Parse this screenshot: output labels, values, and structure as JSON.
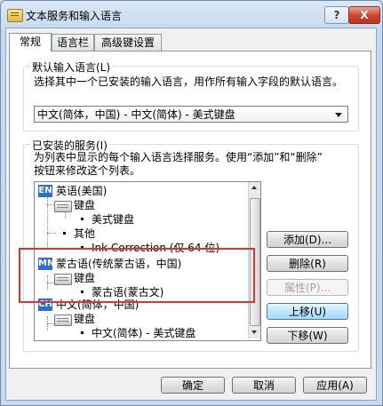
{
  "window": {
    "title": "文本服务和输入语言",
    "help_label": "?",
    "close_label": "X"
  },
  "tabs": [
    {
      "label": "常规",
      "active": true
    },
    {
      "label": "语言栏",
      "active": false
    },
    {
      "label": "高级键设置",
      "active": false
    }
  ],
  "default_lang_group": {
    "label": "默认输入语言(L)",
    "description": "选择其中一个已安装的输入语言，用作所有输入字段的默认语言。",
    "selected_value": "中文(简体，中国) - 中文(简体) - 美式键盘"
  },
  "services_group": {
    "label": "已安装的服务(I)",
    "description_line1": "为列表中显示的每个输入语言选择服务。使用“添加”和“删除”",
    "description_line2": "按钮来修改这个列表。"
  },
  "tree": {
    "nodes": [
      {
        "text": "英语(美国)",
        "badge": "EN",
        "level": 0
      },
      {
        "text": "键盘",
        "level": 1
      },
      {
        "text": "美式键盘",
        "level": 2
      },
      {
        "text": "其他",
        "level": 1
      },
      {
        "text": "Ink Correction (仅 64 位)",
        "level": 2
      },
      {
        "text": "蒙古语(传统蒙古语，中国)",
        "badge": "MN",
        "level": 0
      },
      {
        "text": "键盘",
        "level": 1
      },
      {
        "text": "蒙古语(蒙古文)",
        "level": 2
      },
      {
        "text": "中文(简体，中国)",
        "badge": "CH",
        "level": 0
      },
      {
        "text": "键盘",
        "level": 1
      },
      {
        "text": "中文(简体) - 美式键盘",
        "level": 2
      }
    ]
  },
  "side_buttons": {
    "add": "添加(D)...",
    "remove": "删除(R)",
    "properties": "属性(P)...",
    "move_up": "上移(U)",
    "move_down": "下移(W)"
  },
  "bottom_buttons": {
    "ok": "确定",
    "cancel": "取消",
    "apply": "应用(A)"
  },
  "colors": {
    "highlight_box": "#e0332d",
    "badge_blue": "#2a6fd1"
  }
}
